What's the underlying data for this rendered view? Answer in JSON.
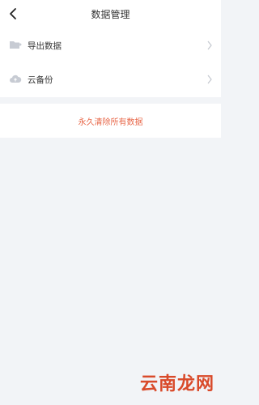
{
  "header": {
    "title": "数据管理",
    "back_icon": "chevron-left-icon"
  },
  "menu": {
    "items": [
      {
        "label": "导出数据",
        "icon": "folder-export-icon"
      },
      {
        "label": "云备份",
        "icon": "cloud-upload-icon"
      }
    ]
  },
  "danger": {
    "clear_label": "永久清除所有数据",
    "color": "#e8684a"
  },
  "watermark": {
    "text": "云南龙网",
    "color": "#d94a2a"
  },
  "colors": {
    "background": "#f2f4f7",
    "surface": "#ffffff",
    "icon": "#c7cbd3"
  }
}
